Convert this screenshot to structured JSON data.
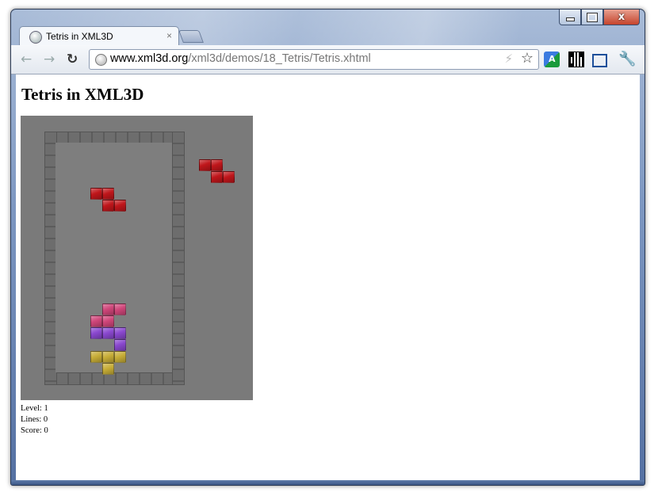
{
  "tab": {
    "title": "Tetris in XML3D",
    "close": "×"
  },
  "toolbar": {
    "back": "←",
    "forward": "→",
    "reload": "↻",
    "url_host": "www.xml3d.org",
    "url_path": "/xml3d/demos/18_Tetris/Tetris.xhtml",
    "bolt": "⚡",
    "star": "☆",
    "translate_letter": "A",
    "wrench": "🔧"
  },
  "caption": {
    "close": "x"
  },
  "page": {
    "title": "Tetris in XML3D"
  },
  "stats": {
    "level": "Level: 1",
    "lines": "Lines: 0",
    "score": "Score: 0"
  },
  "colors": {
    "red": "#c0161b",
    "pink": "#d0467a",
    "purple": "#8a48cf",
    "yellow": "#c7ad37",
    "board": "#7a7a7a"
  },
  "game": {
    "falling_piece": {
      "color": "red",
      "cells": [
        [
          0,
          0
        ],
        [
          1,
          0
        ],
        [
          1,
          1
        ],
        [
          2,
          1
        ]
      ]
    },
    "next_piece": {
      "color": "red",
      "cells": [
        [
          0,
          0
        ],
        [
          1,
          0
        ],
        [
          1,
          1
        ],
        [
          2,
          1
        ]
      ]
    },
    "stack": [
      {
        "color": "pink",
        "cells": [
          [
            1,
            0
          ],
          [
            2,
            0
          ],
          [
            0,
            1
          ],
          [
            1,
            1
          ]
        ]
      },
      {
        "color": "purple",
        "cells": [
          [
            0,
            2
          ],
          [
            1,
            2
          ],
          [
            2,
            2
          ],
          [
            2,
            3
          ]
        ]
      },
      {
        "color": "yellow",
        "cells": [
          [
            0,
            4
          ],
          [
            1,
            4
          ],
          [
            2,
            4
          ],
          [
            1,
            5
          ]
        ]
      }
    ]
  }
}
